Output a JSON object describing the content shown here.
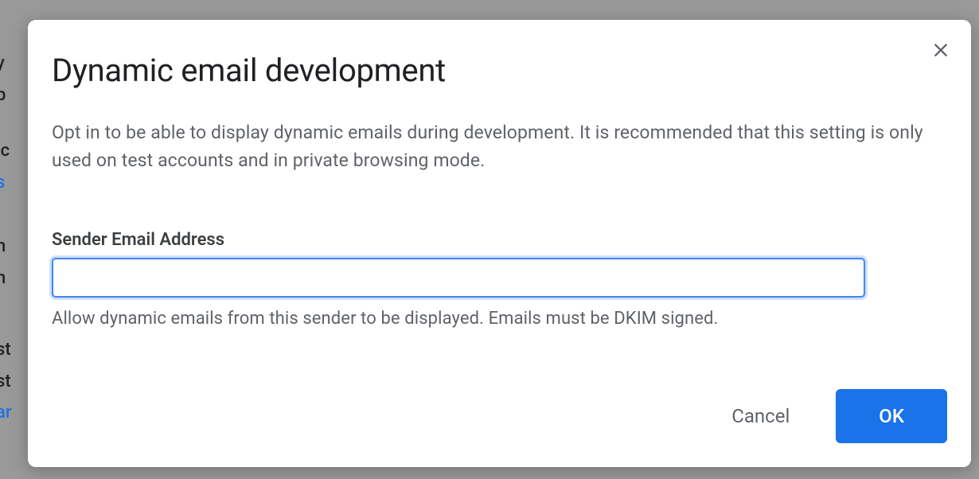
{
  "dialog": {
    "title": "Dynamic email development",
    "description": "Opt in to be able to display dynamic emails during development. It is recommended that this setting is only used on test accounts and in private browsing mode.",
    "sender_field": {
      "label": "Sender Email Address",
      "value": "",
      "helper": "Allow dynamic emails from this sender to be displayed. Emails must be DKIM signed."
    },
    "buttons": {
      "cancel": "Cancel",
      "ok": "OK"
    }
  }
}
